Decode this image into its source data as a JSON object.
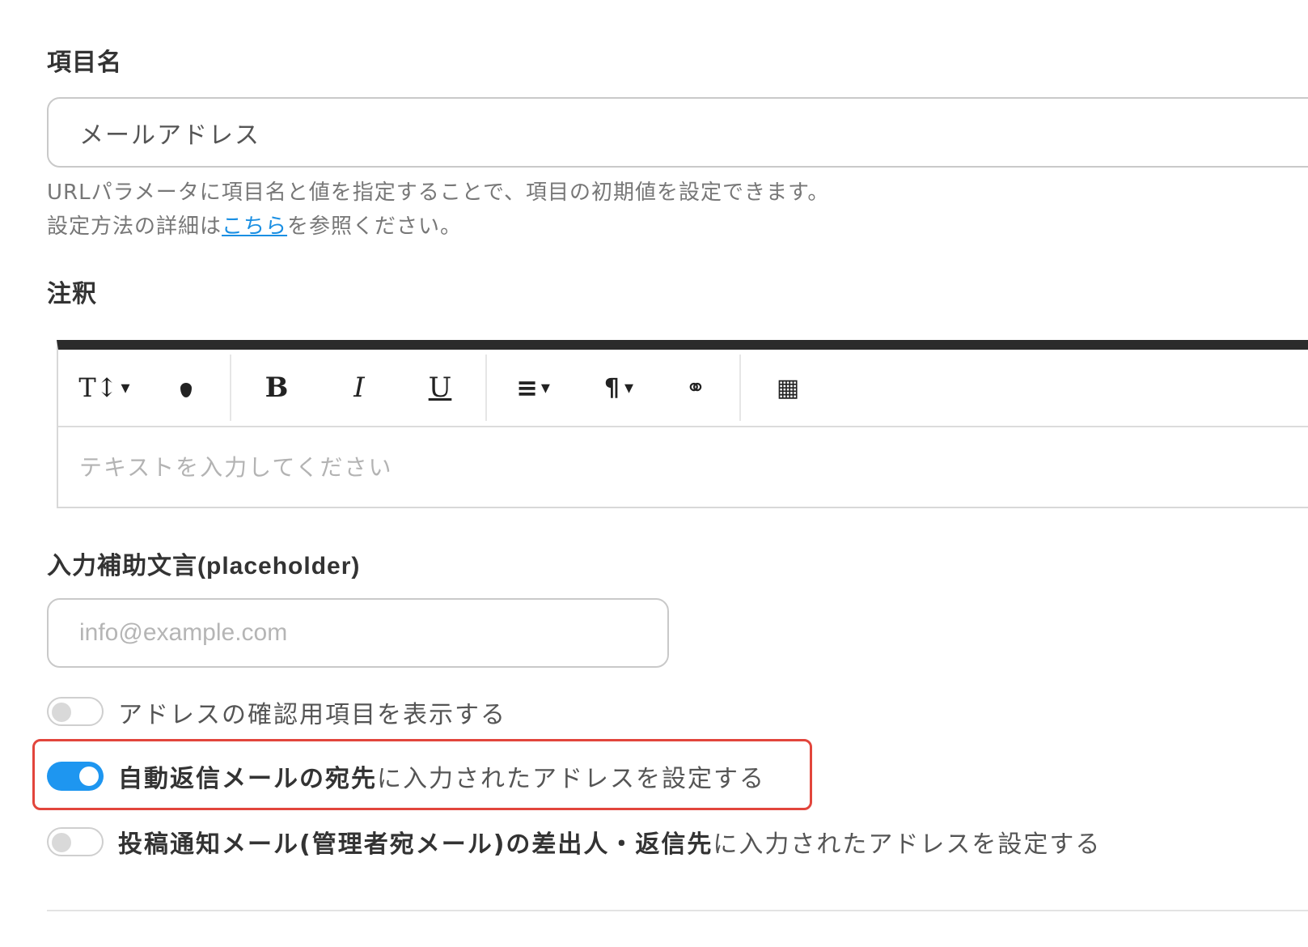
{
  "field_name": {
    "label": "項目名",
    "value": "メールアドレス",
    "help_line1": "URLパラメータに項目名と値を指定することで、項目の初期値を設定できます。",
    "help_line2_before": "設定方法の詳細は",
    "help_link": "こちら",
    "help_line2_after": "を参照ください。"
  },
  "annotation": {
    "label": "注釈",
    "toolbar": {
      "font_size": "T↕",
      "color": "●",
      "bold": "B",
      "italic": "I",
      "underline": "U",
      "align": "≡",
      "paragraph": "¶",
      "link": "⚭",
      "table": "▦",
      "caret": "▾"
    },
    "placeholder": "テキストを入力してください"
  },
  "placeholder_field": {
    "label_jp": "入力補助文言",
    "label_en": "(placeholder)",
    "placeholder": "info@example.com"
  },
  "toggles": [
    {
      "on": false,
      "text_bold": "",
      "text": "アドレスの確認用項目を表示する"
    },
    {
      "on": true,
      "text_bold": "自動返信メールの宛先",
      "text": "に入力されたアドレスを設定する"
    },
    {
      "on": false,
      "text_bold": "投稿通知メール(管理者宛メール)の差出人・返信先",
      "text": "に入力されたアドレスを設定する"
    }
  ],
  "colors": {
    "accent": "#1e96f0",
    "highlight_border": "#e2453c",
    "link": "#1a8fe3"
  }
}
